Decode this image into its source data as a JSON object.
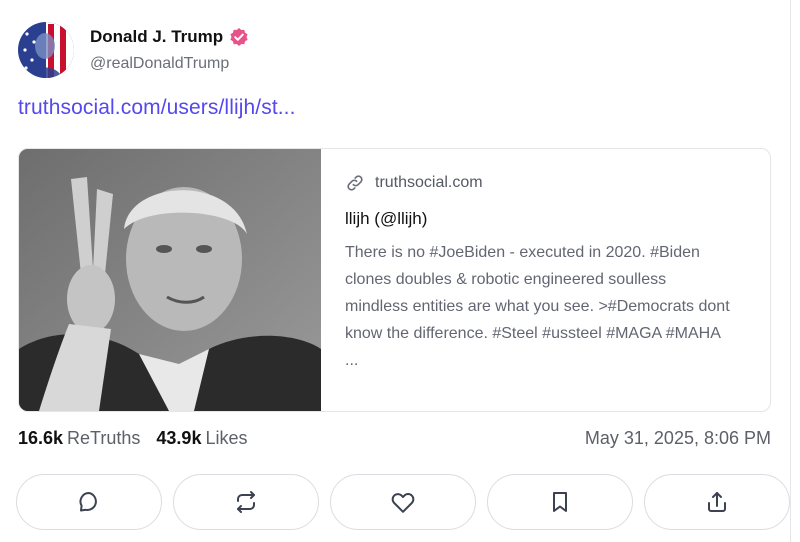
{
  "post": {
    "author": {
      "display_name": "Donald J. Trump",
      "handle": "@realDonaldTrump",
      "verified": true,
      "verified_color": "#e8528a"
    },
    "link_text": "truthsocial.com/users/llijh/st...",
    "link_color": "#5448ee",
    "card": {
      "domain": "truthsocial.com",
      "title": "llijh (@llijh)",
      "description": "There is no #JoeBiden - executed in 2020. #Biden clones doubles & robotic engineered soulless mindless entities are what you see. >#Democrats dont know the difference. #Steel #ussteel #MAGA #MAHA ..."
    },
    "stats": {
      "retruths_count": "16.6k",
      "retruths_label": "ReTruths",
      "likes_count": "43.9k",
      "likes_label": "Likes"
    },
    "timestamp": "May 31, 2025, 8:06 PM",
    "actions": [
      {
        "name": "reply",
        "icon": "comment-icon"
      },
      {
        "name": "retruth",
        "icon": "repost-icon"
      },
      {
        "name": "like",
        "icon": "heart-icon"
      },
      {
        "name": "bookmark",
        "icon": "bookmark-icon"
      },
      {
        "name": "share",
        "icon": "share-icon"
      }
    ]
  }
}
